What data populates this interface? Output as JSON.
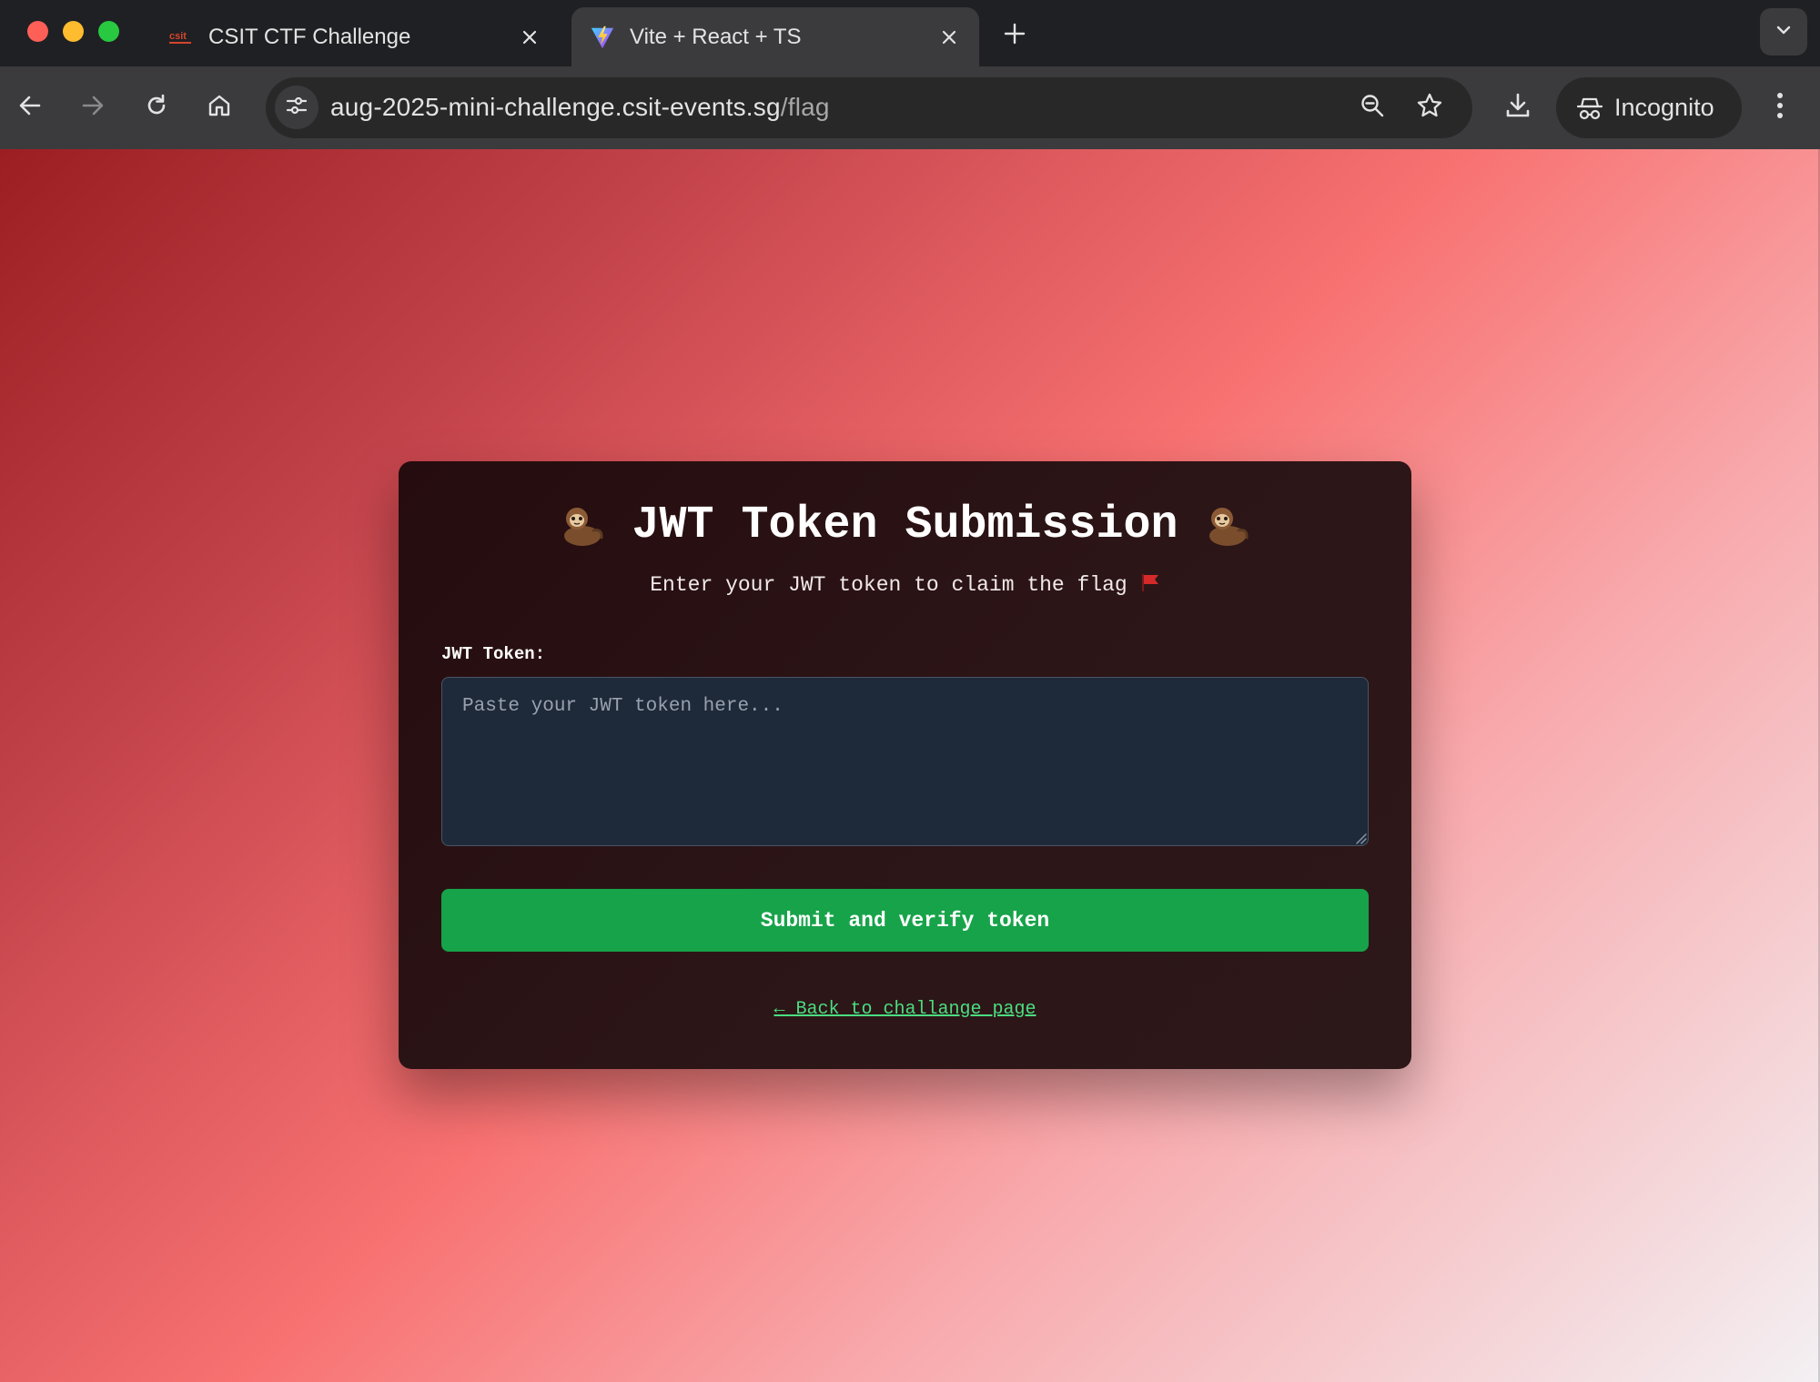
{
  "browser": {
    "tabs": [
      {
        "title": "CSIT CTF Challenge",
        "favicon": "csit-logo-icon",
        "active": false
      },
      {
        "title": "Vite + React + TS",
        "favicon": "vite-logo-icon",
        "active": true
      }
    ],
    "url_host": "aug-2025-mini-challenge.csit-events.sg",
    "url_path": "/flag",
    "profile_label": "Incognito"
  },
  "page": {
    "title": "JWT Token Submission",
    "subtitle": "Enter your JWT token to claim the flag",
    "token_label": "JWT Token:",
    "token_placeholder": "Paste your JWT token here...",
    "token_value": "",
    "submit_label": "Submit and verify token",
    "back_link": "← Back to challange page"
  },
  "colors": {
    "card_bg": "#2a1214",
    "input_bg": "#1e2939",
    "submit_bg": "#17a34a",
    "link": "#4ade80"
  }
}
